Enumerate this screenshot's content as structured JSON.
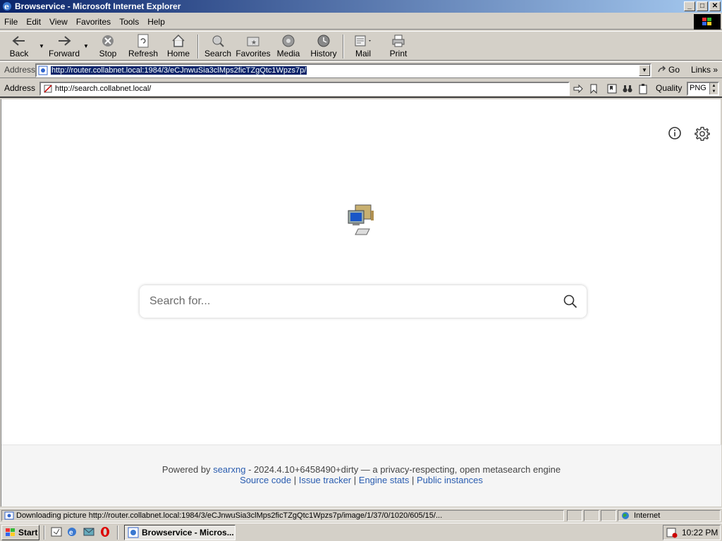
{
  "window": {
    "title": "Browservice - Microsoft Internet Explorer",
    "buttons": {
      "minimize": "_",
      "maximize": "□",
      "close": "✕"
    }
  },
  "menu": [
    "File",
    "Edit",
    "View",
    "Favorites",
    "Tools",
    "Help"
  ],
  "toolbar": {
    "back": "Back",
    "forward": "Forward",
    "stop": "Stop",
    "refresh": "Refresh",
    "home": "Home",
    "search": "Search",
    "favorites": "Favorites",
    "media": "Media",
    "history": "History",
    "mail": "Mail",
    "print": "Print"
  },
  "address_bar": {
    "label": "Address",
    "url": "http://router.collabnet.local:1984/3/eCJnwuSia3clMps2ficTZgQtc1Wpzs7p/",
    "go_label": "Go",
    "links_label": "Links"
  },
  "inner_address_bar": {
    "label": "Address",
    "url": "http://search.collabnet.local/",
    "quality_label": "Quality",
    "quality_value": "PNG"
  },
  "page": {
    "search_placeholder": "Search for...",
    "footer": {
      "powered_by": "Powered by",
      "engine_name": "searxng",
      "version_text": "- 2024.4.10+6458490+dirty — a privacy-respecting, open metasearch engine",
      "links": [
        "Source code",
        "Issue tracker",
        "Engine stats",
        "Public instances"
      ],
      "separator": "|"
    }
  },
  "status_bar": {
    "text": "Downloading picture http://router.collabnet.local:1984/3/eCJnwuSia3clMps2ficTZgQtc1Wpzs7p/image/1/37/0/1020/605/15/...",
    "zone": "Internet"
  },
  "taskbar": {
    "start_label": "Start",
    "task_label": "Browservice - Micros...",
    "clock": "10:22 PM"
  }
}
